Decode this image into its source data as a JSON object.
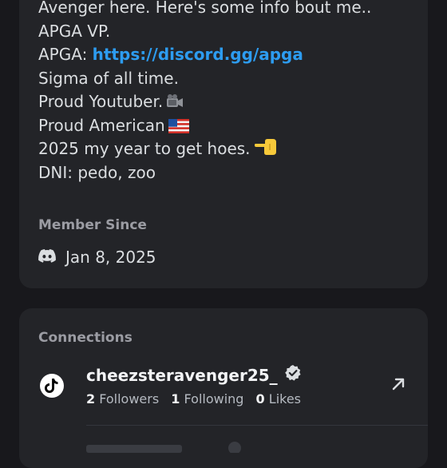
{
  "about": {
    "bio_lines": [
      "Avenger here. Here's some info bout me..",
      "APGA VP.",
      "Sigma of all time.",
      "Proud Youtuber.",
      "Proud American",
      "2025 my year to get hoes.",
      "DNI: pedo, zoo"
    ],
    "apga_prefix": "APGA: ",
    "apga_link": "https://discord.gg/apga"
  },
  "member_since": {
    "title": "Member Since",
    "date": "Jan 8, 2025",
    "icon": "discord-icon"
  },
  "connections": {
    "title": "Connections",
    "account": {
      "platform_icon": "tiktok-icon",
      "handle": "cheezsteravenger25_",
      "followers_count": "2",
      "followers_label": "Followers",
      "following_count": "1",
      "following_label": "Following",
      "likes_count": "0",
      "likes_label": "Likes"
    }
  },
  "colors": {
    "background": "#18181c",
    "card": "#232428",
    "link": "#2d9cf0",
    "muted": "#9b9ca3"
  }
}
